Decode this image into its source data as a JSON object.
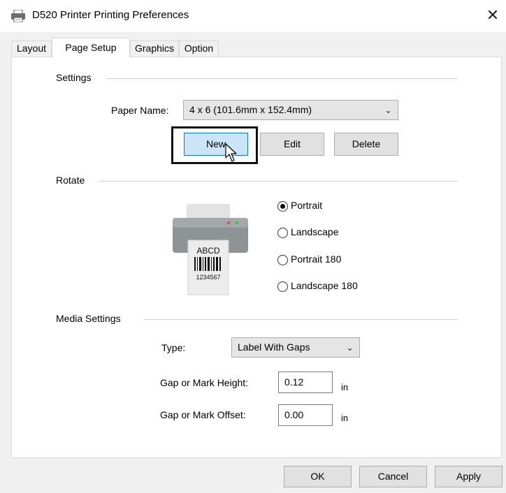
{
  "window": {
    "title": "D520 Printer Printing Preferences",
    "close_label": "✕"
  },
  "tabs": [
    {
      "label": "Layout",
      "active": false
    },
    {
      "label": "Page Setup",
      "active": true
    },
    {
      "label": "Graphics",
      "active": false
    },
    {
      "label": "Option",
      "active": false
    }
  ],
  "settings": {
    "group_label": "Settings",
    "paper_name_label": "Paper Name:",
    "paper_name_value": "4 x 6 (101.6mm x 152.4mm)",
    "new_label": "New",
    "edit_label": "Edit",
    "delete_label": "Delete"
  },
  "rotate": {
    "group_label": "Rotate",
    "options": [
      {
        "label": "Portrait",
        "checked": true
      },
      {
        "label": "Landscape",
        "checked": false
      },
      {
        "label": "Portrait 180",
        "checked": false
      },
      {
        "label": "Landscape 180",
        "checked": false
      }
    ],
    "illustration": {
      "label_text": "ABCD",
      "barcode_number": "1234567"
    }
  },
  "media": {
    "group_label": "Media Settings",
    "type_label": "Type:",
    "type_value": "Label With Gaps",
    "gap_height_label": "Gap or Mark Height:",
    "gap_height_value": "0.12",
    "gap_offset_label": "Gap or Mark Offset:",
    "gap_offset_value": "0.00",
    "unit": "in"
  },
  "footer": {
    "ok_label": "OK",
    "cancel_label": "Cancel",
    "apply_label": "Apply"
  },
  "colors": {
    "focused_button_bg": "#cce4f7",
    "focused_button_border": "#0078d7",
    "led_red": "#e05050",
    "led_green": "#40c040"
  },
  "icons": [
    "printer-icon",
    "close-icon",
    "chevron-down-icon",
    "mouse-cursor-icon"
  ]
}
